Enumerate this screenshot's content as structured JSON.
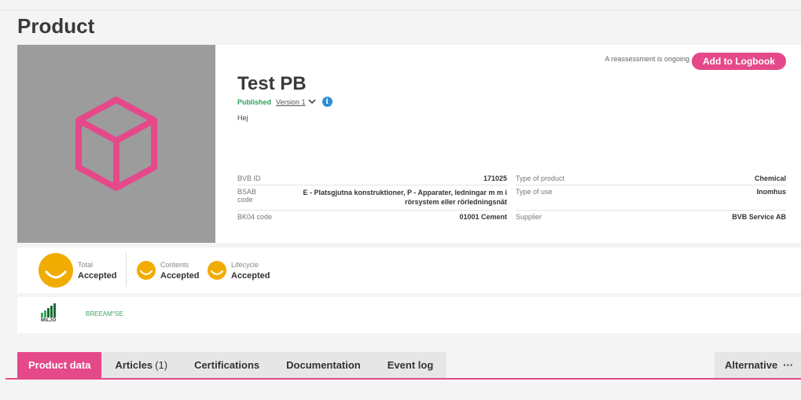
{
  "page": {
    "title": "Product"
  },
  "header": {
    "reassessment_text": "A reassessment is ongoing",
    "add_logbook_label": "Add to Logbook"
  },
  "product": {
    "name": "Test PB",
    "status": "Published",
    "version": "Version 1",
    "description": "Hej",
    "info_icon": "i"
  },
  "details_left": [
    {
      "key": "BVB ID",
      "value": "171025"
    },
    {
      "key": "BSAB code",
      "value": "E - Platsgjutna konstruktioner, P - Apparater, ledningar m m i rörsystem eller rörledningsnät"
    },
    {
      "key": "BK04 code",
      "value": "01001 Cement"
    }
  ],
  "details_right": [
    {
      "key": "Type of product",
      "value": "Chemical"
    },
    {
      "key": "Type of use",
      "value": "Inomhus"
    },
    {
      "key": "Supplier",
      "value": "BVB Service AB"
    }
  ],
  "ratings": [
    {
      "label": "Total",
      "value": "Accepted"
    },
    {
      "label": "Contents",
      "value": "Accepted"
    },
    {
      "label": "Lifecycle",
      "value": "Accepted"
    }
  ],
  "certifications": {
    "miljo_logo_text": "MILJÖ",
    "breeam_text": "BREEAM°SE"
  },
  "tabs": [
    {
      "label": "Product data"
    },
    {
      "label": "Articles",
      "count": "(1)"
    },
    {
      "label": "Certifications"
    },
    {
      "label": "Documentation"
    },
    {
      "label": "Event log"
    }
  ],
  "alternative": {
    "label": "Alternative",
    "more": "···"
  },
  "colors": {
    "accent": "#e5498a",
    "published": "#2aa55b",
    "rating": "#f0ac00",
    "info": "#2a8fd6"
  },
  "icons": [
    "cube-icon",
    "chevron-down-icon",
    "info-icon",
    "smiley-icon",
    "more-dots-icon"
  ]
}
